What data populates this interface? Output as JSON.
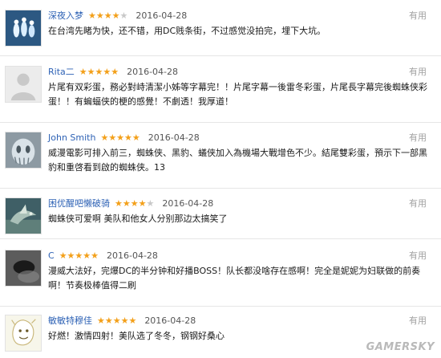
{
  "comments": [
    {
      "user": "深夜入梦",
      "rating": 4,
      "date": "2016-04-28",
      "useful_label": "有用",
      "text": "在台湾先睹为快，还不错，用DC贱条街，不过感觉没拍完，埋下大坑。",
      "avatar_icon": "glowing-figures-avatar-icon"
    },
    {
      "user": "Rita二",
      "rating": 5,
      "date": "2016-04-28",
      "useful_label": "有用",
      "text": "片尾有双彩蛋，務必對峙清潔小姊等字幕完！！片尾字幕一後雷冬彩蛋，片尾長字幕完後蜘蛛侠彩蛋！！有蝙蝠侠的梗的感覺！不劇透！我厚道！",
      "avatar_icon": "default-avatar-icon"
    },
    {
      "user": "John Smith",
      "rating": 5,
      "date": "2016-04-28",
      "useful_label": "有用",
      "text": "威漫電影可排入前三，蜘蛛侠、黑豹、蟻侠加入為機場大戰增色不少。結尾雙彩蛋，預示下一部黑豹和重啓看到啟的蜘蛛侠。13",
      "avatar_icon": "ghost-face-avatar-icon"
    },
    {
      "user": "困优醒吧懒破骑",
      "rating": 4,
      "date": "2016-04-28",
      "useful_label": "有用",
      "text": "蜘蛛侠可爱啊 美队和他女人分别那边太搞笑了",
      "avatar_icon": "bird-scene-avatar-icon"
    },
    {
      "user": "C",
      "rating": 5,
      "date": "2016-04-28",
      "useful_label": "有用",
      "text": "漫威大法好，完爆DC的半分钟和好播BOSS！队长都没啥存在感啊！完全是妮妮为妇联做的前奏啊！节奏极棒值得二刷",
      "avatar_icon": "dark-blur-avatar-icon"
    },
    {
      "user": "敏敏特穆佳",
      "rating": 5,
      "date": "2016-04-28",
      "useful_label": "有用",
      "text": "好燃！激情四射！美队选了冬冬，钢钢好桑心",
      "avatar_icon": "cartoon-doodle-avatar-icon"
    }
  ],
  "watermark": "GAMERSKY"
}
